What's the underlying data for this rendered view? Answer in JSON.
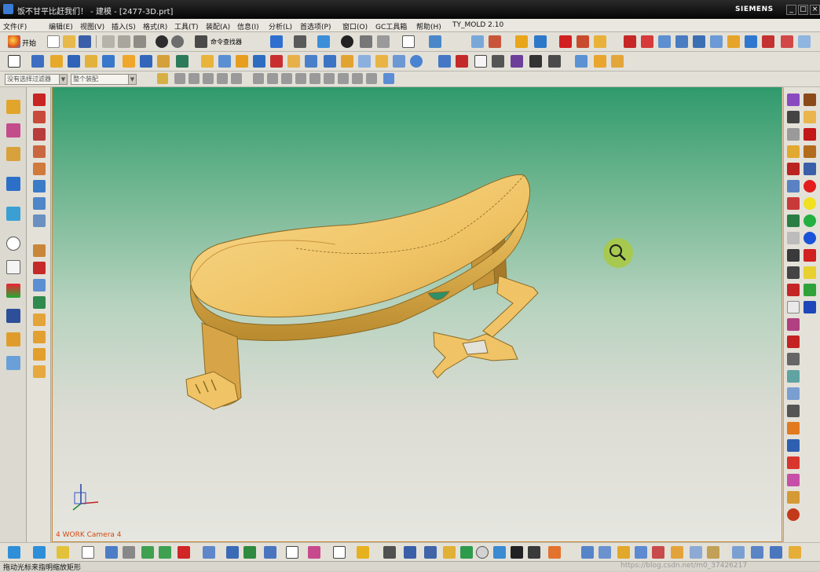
{
  "window": {
    "title": "饭不甘平比赶我们！ - 建模 - [2477-3D.prt]",
    "brand": "SIEMENS",
    "controls": [
      "_",
      "□",
      "×"
    ]
  },
  "menu": [
    "文件(F)",
    "编辑(E)",
    "视图(V)",
    "插入(S)",
    "格式(R)",
    "工具(T)",
    "装配(A)",
    "信息(I)",
    "分析(L)",
    "首选项(P)",
    "窗口(O)",
    "GC工具箱",
    "帮助(H)",
    "TY_MOLD 2.10"
  ],
  "toolbar": {
    "start_label": "开始",
    "command_finder_label": "命令查找器",
    "selection_filter": "没有选择过滤器",
    "assembly_scope": "整个装配"
  },
  "viewport": {
    "camera_label": "4 WORK Camera 4",
    "zoom_cursor": "magnifier-icon"
  },
  "status": {
    "prompt": "拖动光标来指明缩放矩形",
    "watermark": "https://blog.csdn.net/m0_37426217"
  },
  "colors": {
    "part_fill": "#f0c466",
    "part_shade": "#b98a2e",
    "part_edge": "#8a6a25",
    "bg_top": "#2f9a6c",
    "bg_bottom": "#e6e6e0",
    "title_bar": "#111111",
    "camera_label": "#d24a10"
  }
}
